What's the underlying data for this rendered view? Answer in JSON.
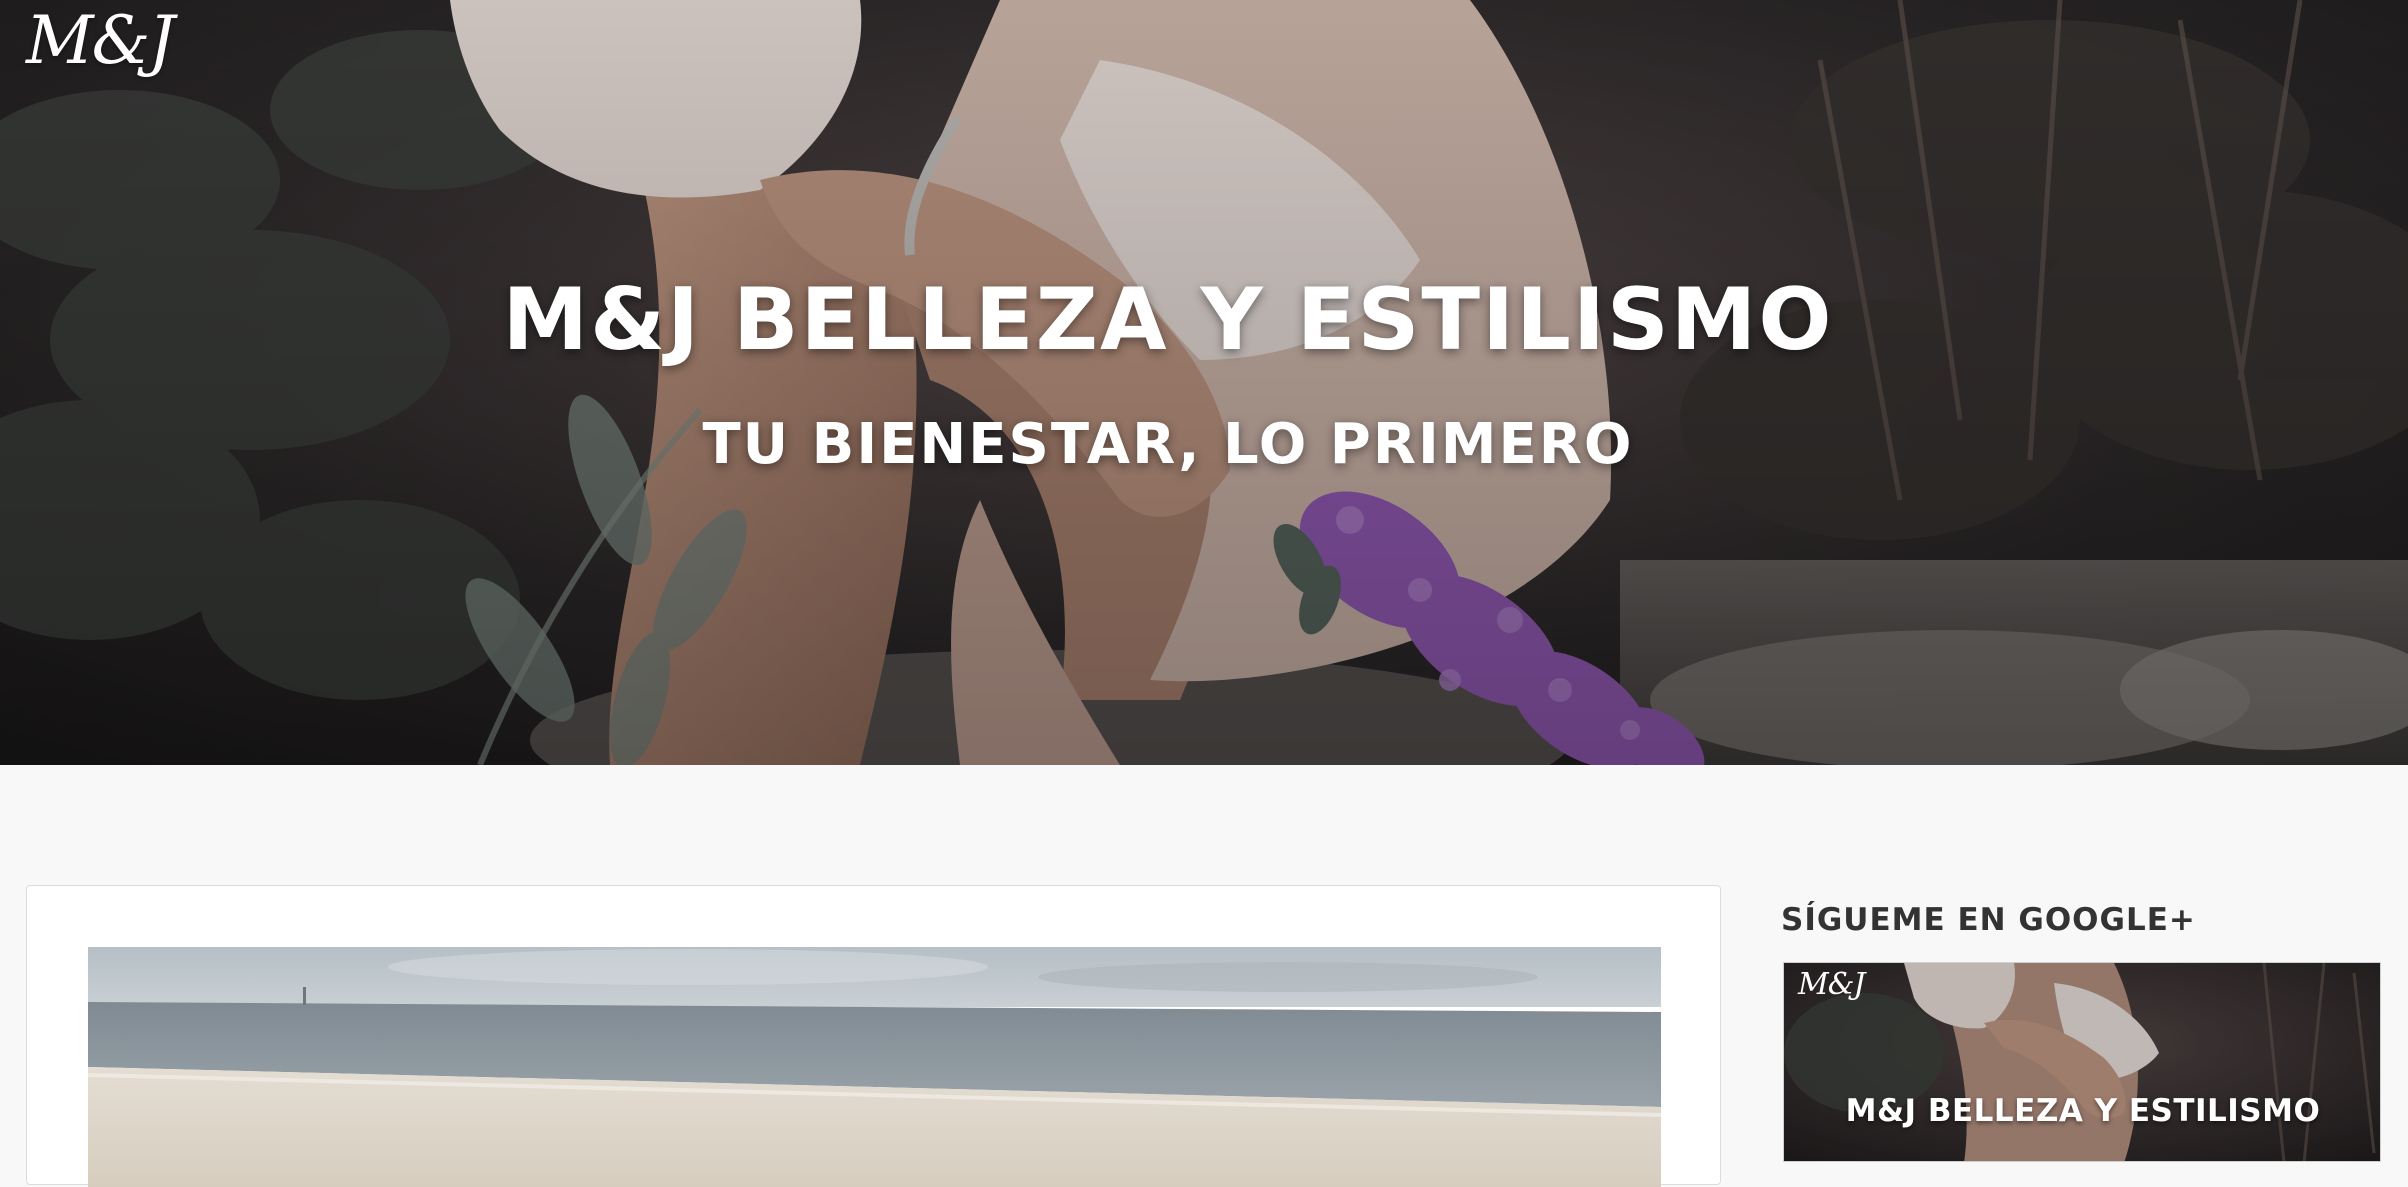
{
  "header": {
    "logo_text": "M&J",
    "title": "M&J BELLEZA Y ESTILISMO",
    "subtitle": "TU BIENESTAR, LO PRIMERO"
  },
  "sidebar": {
    "widget_title": "SÍGUEME EN GOOGLE+",
    "banner": {
      "logo_text": "M&J",
      "title": "M&J BELLEZA Y ESTILISMO"
    }
  },
  "colors": {
    "background": "#f8f8f8",
    "card": "#ffffff",
    "hero_text": "#ffffff",
    "widget_title": "#333333",
    "flowers": "#9b5fbf"
  }
}
